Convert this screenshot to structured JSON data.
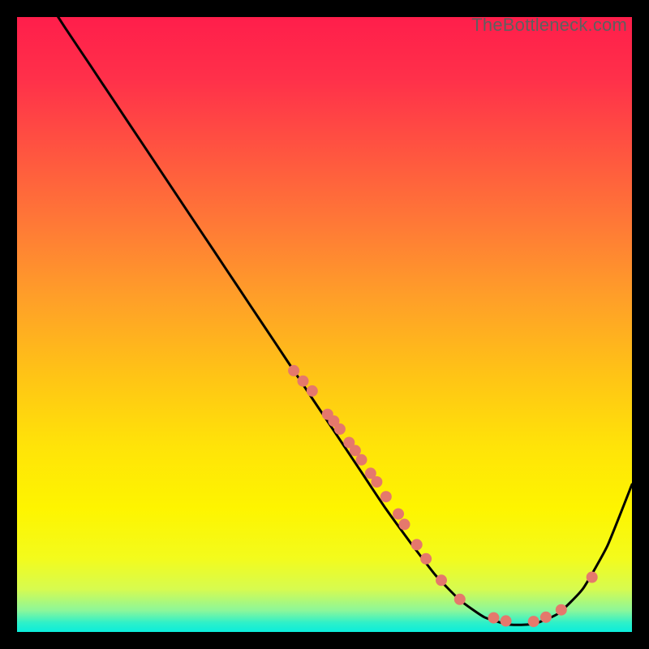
{
  "watermark": "TheBottleneck.com",
  "colors": {
    "gradient_stops": [
      {
        "offset": 0.0,
        "color": "#ff1e4b"
      },
      {
        "offset": 0.1,
        "color": "#ff304a"
      },
      {
        "offset": 0.22,
        "color": "#ff5540"
      },
      {
        "offset": 0.34,
        "color": "#ff7a36"
      },
      {
        "offset": 0.46,
        "color": "#ffa028"
      },
      {
        "offset": 0.58,
        "color": "#ffc316"
      },
      {
        "offset": 0.7,
        "color": "#ffe408"
      },
      {
        "offset": 0.8,
        "color": "#fef500"
      },
      {
        "offset": 0.88,
        "color": "#f3fb1c"
      },
      {
        "offset": 0.93,
        "color": "#d7fb4f"
      },
      {
        "offset": 0.965,
        "color": "#8cf79a"
      },
      {
        "offset": 0.985,
        "color": "#2ef0c9"
      },
      {
        "offset": 1.0,
        "color": "#0beddb"
      }
    ],
    "curve": "#000000",
    "points": "#e5786c"
  },
  "chart_data": {
    "type": "line",
    "title": "",
    "xlabel": "",
    "ylabel": "",
    "xlim": [
      0,
      100
    ],
    "ylim": [
      0,
      100
    ],
    "grid": false,
    "series": [
      {
        "name": "bottleneck-curve",
        "x": [
          0,
          4,
          8,
          12,
          16,
          20,
          24,
          28,
          32,
          36,
          40,
          44,
          48,
          52,
          56,
          60,
          64,
          68,
          72,
          76,
          80,
          84,
          88,
          92,
          96,
          100
        ],
        "y": [
          108,
          104,
          98,
          92,
          86,
          80,
          74,
          68,
          62,
          56,
          50,
          44,
          38,
          32,
          26,
          20,
          14.5,
          9.3,
          5.2,
          2.4,
          1.2,
          1.3,
          3.0,
          7.0,
          14.0,
          24.0
        ]
      }
    ],
    "points_overlay": {
      "name": "highlighted-points",
      "coords": [
        [
          45.0,
          42.5
        ],
        [
          46.5,
          40.8
        ],
        [
          48.0,
          39.2
        ],
        [
          50.5,
          35.4
        ],
        [
          51.5,
          34.3
        ],
        [
          52.5,
          33.0
        ],
        [
          54.0,
          30.8
        ],
        [
          55.0,
          29.5
        ],
        [
          56.0,
          28.0
        ],
        [
          57.5,
          25.8
        ],
        [
          58.5,
          24.4
        ],
        [
          60.0,
          22.0
        ],
        [
          62.0,
          19.2
        ],
        [
          63.0,
          17.5
        ],
        [
          65.0,
          14.2
        ],
        [
          66.5,
          11.9
        ],
        [
          69.0,
          8.4
        ],
        [
          72.0,
          5.3
        ],
        [
          77.5,
          2.3
        ],
        [
          79.5,
          1.8
        ],
        [
          84.0,
          1.7
        ],
        [
          86.0,
          2.4
        ],
        [
          88.5,
          3.6
        ],
        [
          93.5,
          8.9
        ]
      ]
    }
  }
}
